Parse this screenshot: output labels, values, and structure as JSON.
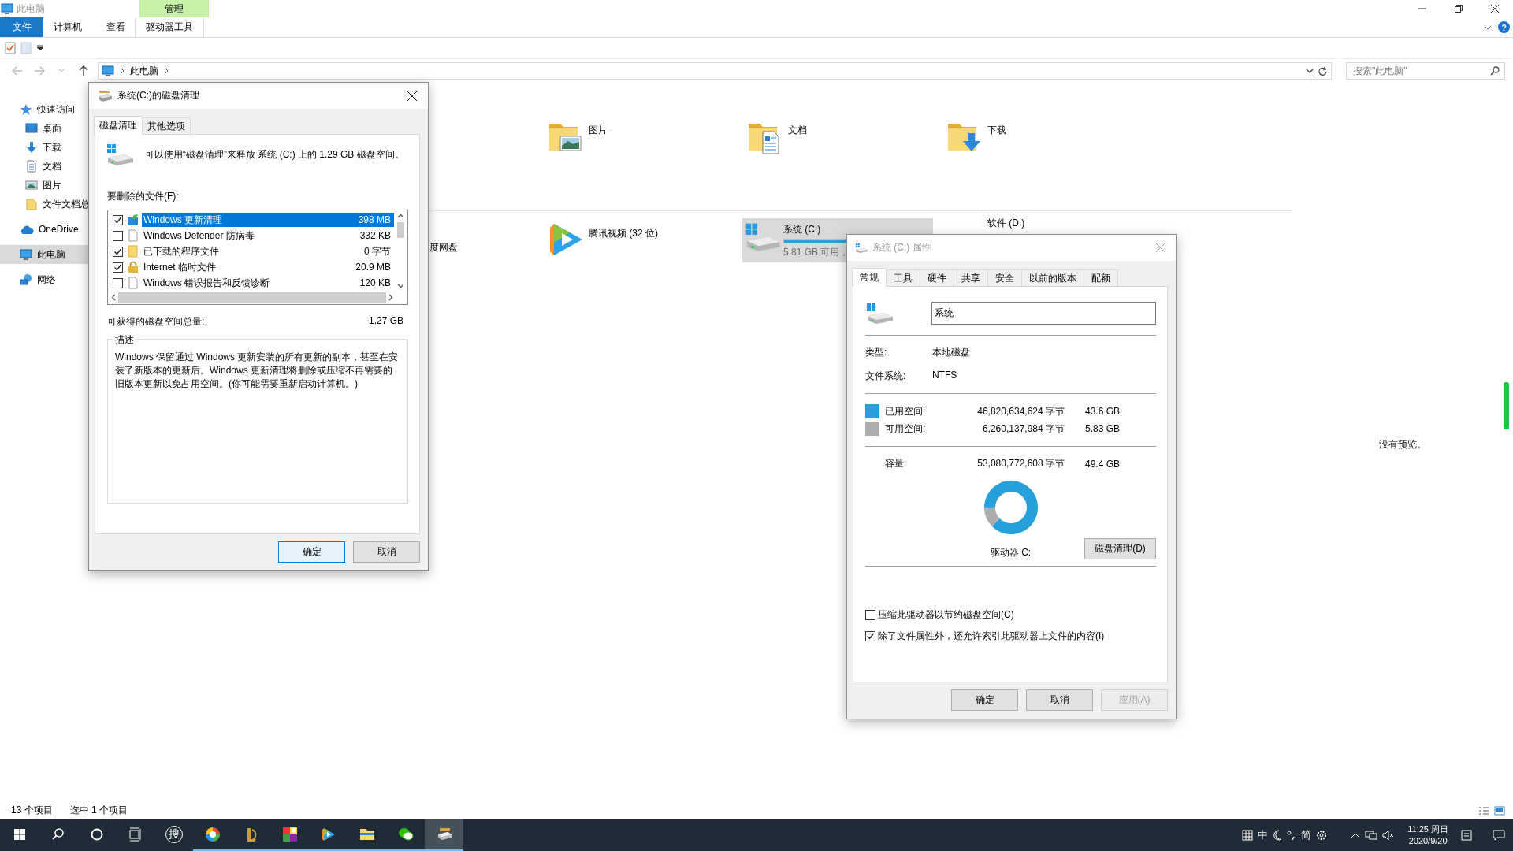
{
  "window": {
    "title": "此电脑"
  },
  "ribbon": {
    "context_header": "管理",
    "tabs": [
      {
        "label": "文件",
        "kind": "file"
      },
      {
        "label": "计算机",
        "kind": "normal"
      },
      {
        "label": "查看",
        "kind": "normal"
      },
      {
        "label": "驱动器工具",
        "kind": "contextual"
      }
    ],
    "help": "?"
  },
  "address": {
    "crumbs": [
      "此电脑"
    ]
  },
  "search": {
    "placeholder": "搜索\"此电脑\""
  },
  "nav": {
    "items": [
      {
        "label": "快速访问",
        "kind": "star",
        "selected": false,
        "children": [
          {
            "label": "桌面",
            "kind": "desktop",
            "selected": false
          },
          {
            "label": "下载",
            "kind": "download",
            "selected": false
          },
          {
            "label": "文档",
            "kind": "document",
            "selected": false
          },
          {
            "label": "图片",
            "kind": "picture",
            "selected": false
          },
          {
            "label": "文件文档总",
            "kind": "folder",
            "selected": false
          }
        ]
      },
      {
        "label": "OneDrive",
        "kind": "cloud",
        "selected": false
      },
      {
        "label": "此电脑",
        "kind": "computer",
        "selected": true
      },
      {
        "label": "网络",
        "kind": "network",
        "selected": false
      }
    ]
  },
  "folders": [
    {
      "label": "图片",
      "kind": "pictures"
    },
    {
      "label": "文档",
      "kind": "documents"
    },
    {
      "label": "下载",
      "kind": "downloads"
    }
  ],
  "devices": [
    {
      "label": "度网盘",
      "kind": "covered",
      "selected": false
    },
    {
      "label": "腾讯视频 (32 位)",
      "kind": "app",
      "selected": false
    },
    {
      "label": "系统 (C:)",
      "kind": "drive",
      "selected": true,
      "level": 0.88,
      "free": "5.81 GB 可用，"
    },
    {
      "label": "软件 (D:)",
      "kind": "drive-covered",
      "selected": false
    }
  ],
  "preview": {
    "message": "没有预览。"
  },
  "status_bar": {
    "items": [
      "13 个项目",
      "选中 1 个项目"
    ]
  },
  "cleanup": {
    "title": "系统(C:)的磁盘清理",
    "tabs": [
      {
        "label": "磁盘清理",
        "selected": true
      },
      {
        "label": "其他选项",
        "selected": false
      }
    ],
    "intro": "可以使用“磁盘清理”来释放 系统 (C:) 上的 1.29 GB 磁盘空间。",
    "list_label": "要删除的文件(F):",
    "files": [
      {
        "name": "Windows 更新清理",
        "size": "398 MB",
        "kind": "update",
        "checked": true,
        "selected": true
      },
      {
        "name": "Windows Defender 防病毒",
        "size": "332 KB",
        "kind": "blank",
        "checked": false,
        "selected": false
      },
      {
        "name": "已下载的程序文件",
        "size": "0 字节",
        "kind": "folder",
        "checked": true,
        "selected": false
      },
      {
        "name": "Internet 临时文件",
        "size": "20.9 MB",
        "kind": "lock",
        "checked": true,
        "selected": false
      },
      {
        "name": "Windows 错误报告和反馈诊断",
        "size": "120 KB",
        "kind": "blank",
        "checked": false,
        "selected": false
      }
    ],
    "total_label": "可获得的磁盘空间总量:",
    "total": "1.27 GB",
    "description_label": "描述",
    "description": "Windows 保留通过 Windows 更新安装的所有更新的副本，甚至在安装了新版本的更新后。Windows 更新清理将删除或压缩不再需要的旧版本更新以免占用空间。(你可能需要重新启动计算机。)",
    "buttons": [
      {
        "label": "确定",
        "default": true
      },
      {
        "label": "取消",
        "default": false
      }
    ]
  },
  "properties": {
    "title": "系统 (C:) 属性",
    "tabs": [
      {
        "label": "常规",
        "selected": true
      },
      {
        "label": "工具",
        "selected": false
      },
      {
        "label": "硬件",
        "selected": false
      },
      {
        "label": "共享",
        "selected": false
      },
      {
        "label": "安全",
        "selected": false
      },
      {
        "label": "以前的版本",
        "selected": false
      },
      {
        "label": "配额",
        "selected": false
      }
    ],
    "name_value": "系统",
    "info": [
      {
        "label": "类型:",
        "value": "本地磁盘"
      },
      {
        "label": "文件系统:",
        "value": "NTFS"
      }
    ],
    "space": [
      {
        "label": "已用空间:",
        "bytes": "46,820,634,624 字节",
        "size": "43.6 GB",
        "color": "#26a0da"
      },
      {
        "label": "可用空间:",
        "bytes": "6,260,137,984 字节",
        "size": "5.83 GB",
        "color": "#adadad"
      }
    ],
    "capacity": {
      "label": "容量:",
      "bytes": "53,080,772,608 字节",
      "size": "49.4 GB"
    },
    "chart_data": {
      "type": "donut",
      "values": [
        88.2,
        11.8
      ]
    },
    "drive_label": "驱动器 C:",
    "cleanup_button": "磁盘清理(D)",
    "options": [
      {
        "label": "压缩此驱动器以节约磁盘空间(C)",
        "checked": false
      },
      {
        "label": "除了文件属性外，还允许索引此驱动器上文件的内容(I)",
        "checked": true
      }
    ],
    "buttons": [
      {
        "label": "确定",
        "disabled": false
      },
      {
        "label": "取消",
        "disabled": false
      },
      {
        "label": "应用(A)",
        "disabled": true
      }
    ]
  },
  "taskbar": {
    "apps": [
      {
        "kind": "start",
        "running": false,
        "active": false
      },
      {
        "kind": "search",
        "running": false,
        "active": false
      },
      {
        "kind": "cortana",
        "running": false,
        "active": false
      },
      {
        "kind": "taskview",
        "running": false,
        "active": false
      },
      {
        "kind": "ime",
        "label": "搜",
        "running": false,
        "active": false
      },
      {
        "kind": "colorball",
        "running": true,
        "active": false
      },
      {
        "kind": "emblem",
        "running": true,
        "active": false
      },
      {
        "kind": "gallery",
        "running": true,
        "active": false
      },
      {
        "kind": "video",
        "running": true,
        "active": false
      },
      {
        "kind": "explorer",
        "running": true,
        "active": false
      },
      {
        "kind": "wechat",
        "running": true,
        "active": false
      },
      {
        "kind": "cleanup",
        "running": true,
        "active": true
      }
    ],
    "ime": [
      "中",
      "简"
    ],
    "time": "11:25 周日",
    "date": "2020/9/20"
  }
}
